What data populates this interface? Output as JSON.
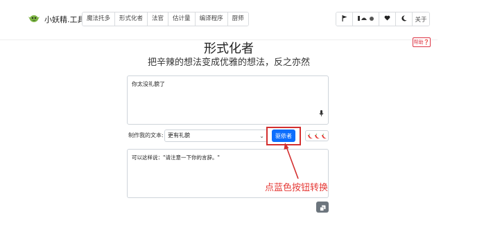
{
  "brand": {
    "name": "小妖精.工具",
    "logo_icon": "goblin-icon"
  },
  "nav": {
    "items": [
      "魔法托多",
      "形式化者",
      "法官",
      "估计量",
      "编译程序",
      "厨师"
    ]
  },
  "toolbar": {
    "theme_label": "关于",
    "icons": [
      "flag-icon",
      "hats-icon",
      "heart-icon",
      "moon-icon"
    ]
  },
  "help": {
    "label": "帮助❓"
  },
  "page": {
    "title": "形式化者",
    "subtitle": "把辛辣的想法变成优雅的想法，反之亦然"
  },
  "input": {
    "value": "你太没礼貌了"
  },
  "controls": {
    "label": "制作我的文本:",
    "select_value": "更有礼貌",
    "go_label": "驱依者",
    "spice_icon": "chili-pepper-icon"
  },
  "output": {
    "value": "可以这样说：\"请注意一下你的言辞。\""
  },
  "annotation": {
    "text": "点蓝色按钮转换",
    "color": "#e53935"
  },
  "colors": {
    "primary": "#0d6efd",
    "danger": "#dc3545",
    "secondary": "#6c757d"
  }
}
